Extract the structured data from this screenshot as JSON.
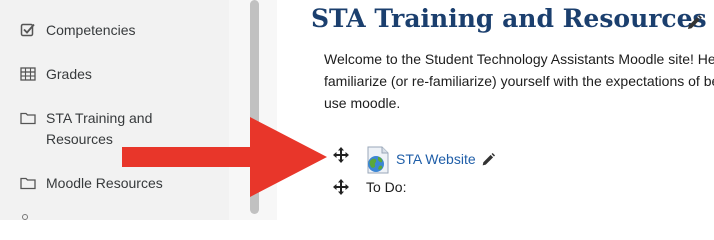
{
  "sidebar": {
    "items": [
      {
        "label": "Competencies",
        "icon": "checkbox-icon"
      },
      {
        "label": "Grades",
        "icon": "table-icon"
      },
      {
        "label": "STA Training and",
        "label2": "Resources",
        "icon": "folder-icon"
      },
      {
        "label": "Moodle Resources",
        "icon": "folder-icon"
      }
    ]
  },
  "main": {
    "title": "STA Training and Resources",
    "welcome_lines": [
      "Welcome to the Student Technology Assistants Moodle site! He",
      "familiarize (or re-familiarize) yourself with the expectations of be",
      "use moodle."
    ],
    "activity": {
      "label": "STA Website",
      "icon": "url-globe-icon"
    },
    "todo_label": "To Do:"
  },
  "colors": {
    "title": "#1b3f6e",
    "link": "#1f5ea8",
    "sidebar_bg": "#f2f2f2",
    "annotation_arrow": "#e8362a"
  }
}
